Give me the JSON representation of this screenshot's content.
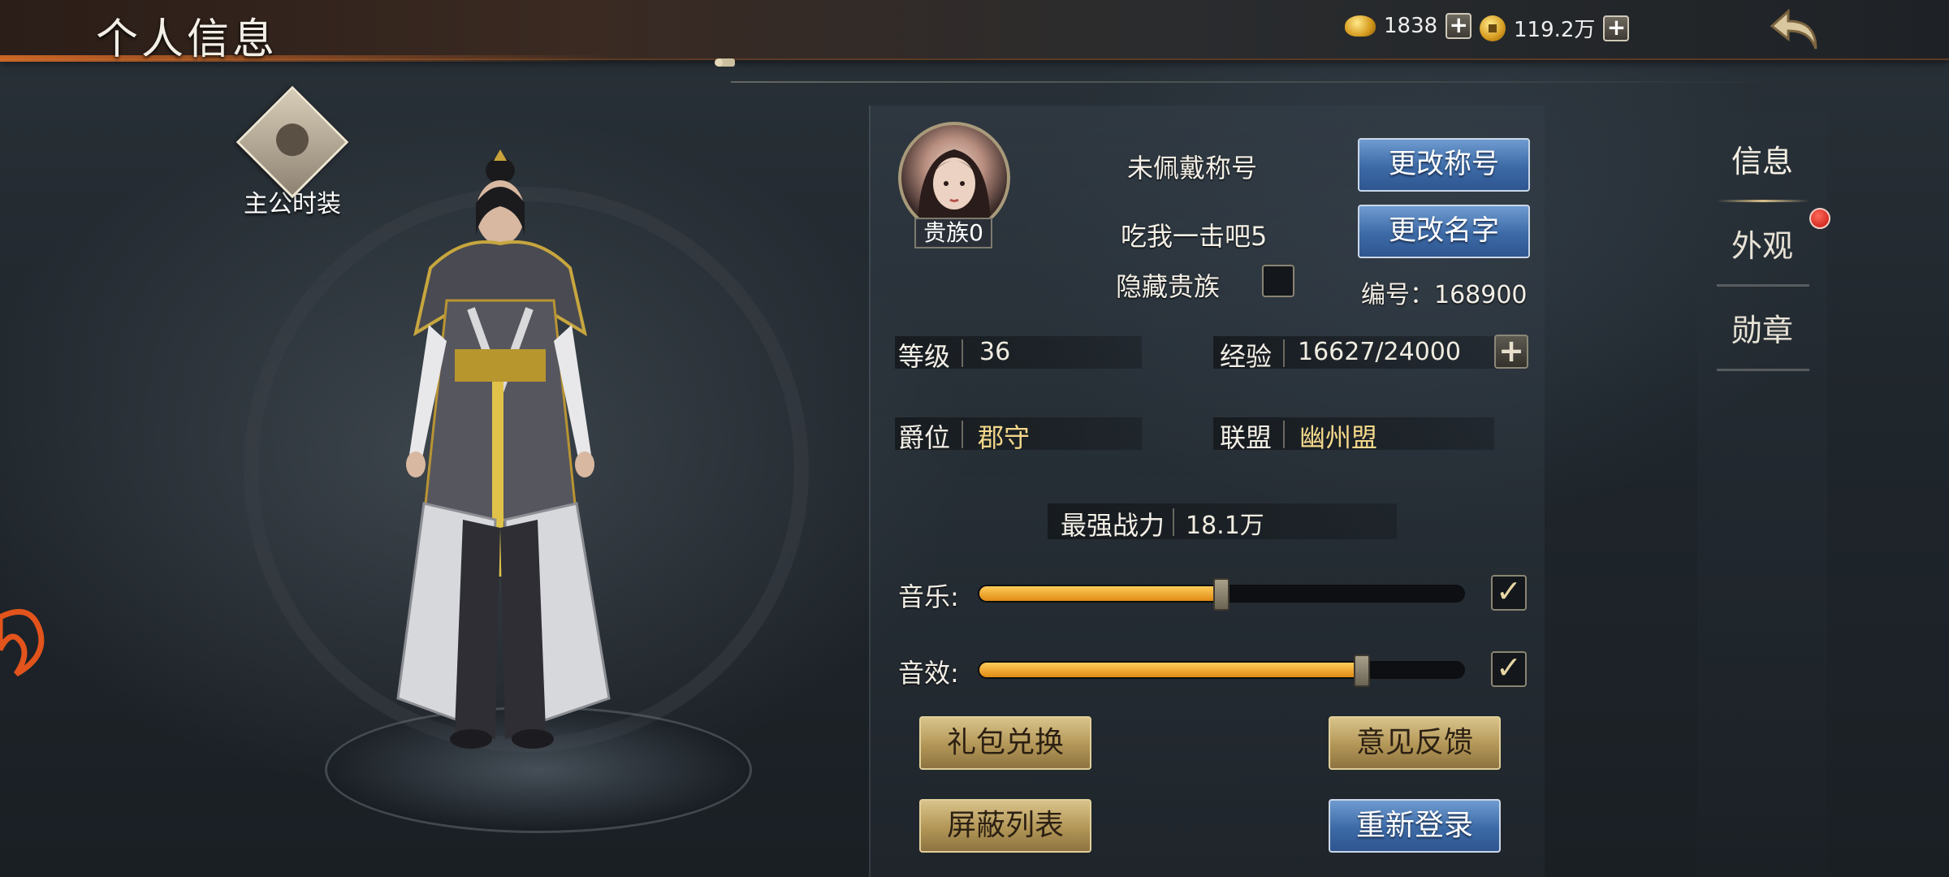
{
  "header": {
    "title": "个人信息",
    "gold_ingot": "1838",
    "coins": "119.2万"
  },
  "left": {
    "fashion_label": "主公时装"
  },
  "profile": {
    "noble_tag": "贵族0",
    "title_status": "未佩戴称号",
    "player_name": "吃我一击吧5",
    "hide_noble_label": "隐藏贵族",
    "change_title_button": "更改称号",
    "change_name_button": "更改名字",
    "id_text": "编号：168900"
  },
  "stats": {
    "level_label": "等级",
    "level_value": "36",
    "exp_label": "经验",
    "exp_value": "16627/24000",
    "rank_label": "爵位",
    "rank_value": "郡守",
    "alliance_label": "联盟",
    "alliance_value": "幽州盟",
    "power_label": "最强战力",
    "power_value": "18.1万"
  },
  "audio": {
    "music_label": "音乐:",
    "music_level": 0.5,
    "music_enabled": true,
    "sfx_label": "音效:",
    "sfx_level": 0.79,
    "sfx_enabled": true
  },
  "actions": {
    "gift_exchange": "礼包兑换",
    "feedback": "意见反馈",
    "block_list": "屏蔽列表",
    "relogin": "重新登录"
  },
  "tabs": [
    {
      "label": "信息",
      "active": true
    },
    {
      "label": "外观",
      "active": false,
      "badge": true
    },
    {
      "label": "勋章",
      "active": false
    }
  ],
  "colors": {
    "accent_gold": "#f4d88a",
    "button_blue": "#3c6aa6",
    "button_gold": "#b29657",
    "slider_fill": "#e08a14",
    "badge_red": "#c5140c"
  }
}
